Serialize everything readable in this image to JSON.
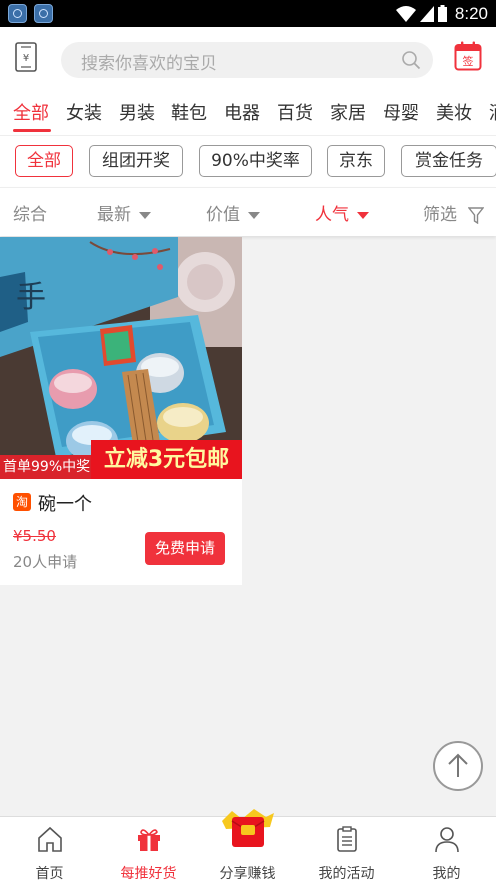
{
  "status_bar": {
    "time": "8:20"
  },
  "header": {
    "search_placeholder": "搜索你喜欢的宝贝",
    "sign_label": "签"
  },
  "categories": [
    "全部",
    "女装",
    "男装",
    "鞋包",
    "电器",
    "百货",
    "家居",
    "母婴",
    "美妆",
    "酒"
  ],
  "filters": [
    "全部",
    "组团开奖",
    "90%中奖率",
    "京东",
    "赏金任务"
  ],
  "sort": {
    "comprehensive": "综合",
    "newest": "最新",
    "value": "价值",
    "popularity": "人气",
    "filter": "筛选"
  },
  "product": {
    "promo_left": "首单99%中奖",
    "promo_right": "立减3元包邮",
    "platform_badge": "淘",
    "title": "碗一个",
    "price": "¥5.50",
    "applicants": "20人申请",
    "apply_button": "免费申请"
  },
  "bottom_nav": [
    "首页",
    "每推好货",
    "分享赚钱",
    "我的活动",
    "我的"
  ],
  "colors": {
    "accent": "#f0323c"
  }
}
